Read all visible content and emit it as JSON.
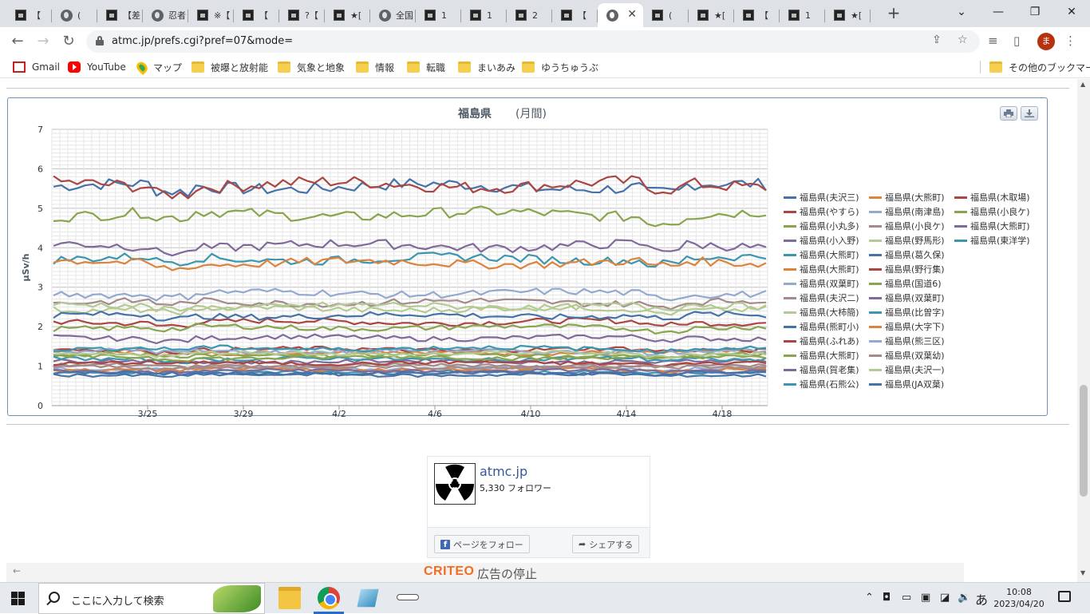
{
  "browser": {
    "tabs": [
      {
        "title": "【",
        "fav": "site"
      },
      {
        "title": "(",
        "fav": "globe"
      },
      {
        "title": "【差",
        "fav": "site"
      },
      {
        "title": "忍者",
        "fav": "globe"
      },
      {
        "title": "※【",
        "fav": "site"
      },
      {
        "title": "【",
        "fav": "site"
      },
      {
        "title": "?【",
        "fav": "site"
      },
      {
        "title": "★[",
        "fav": "site"
      },
      {
        "title": "全国",
        "fav": "globe"
      },
      {
        "title": "1",
        "fav": "site"
      },
      {
        "title": "1",
        "fav": "site"
      },
      {
        "title": "2",
        "fav": "site"
      },
      {
        "title": "【",
        "fav": "site"
      },
      {
        "title": "",
        "fav": "globe",
        "active": true
      },
      {
        "title": "(",
        "fav": "site"
      },
      {
        "title": "★[",
        "fav": "site"
      },
      {
        "title": "【",
        "fav": "site"
      },
      {
        "title": "1",
        "fav": "site"
      },
      {
        "title": "★[",
        "fav": "site"
      }
    ],
    "url": "atmc.jp/prefs.cgi?pref=07&mode=",
    "avatar_letter": "ま",
    "bookmarks": [
      {
        "label": "Gmail",
        "icon": "gmail-icon"
      },
      {
        "label": "YouTube",
        "icon": "youtube-icon"
      },
      {
        "label": "マップ",
        "icon": "maps-icon"
      },
      {
        "label": "被曝と放射能",
        "icon": "folder-icon"
      },
      {
        "label": "気象と地象",
        "icon": "folder-icon"
      },
      {
        "label": "情報",
        "icon": "folder-icon"
      },
      {
        "label": "転職",
        "icon": "folder-icon"
      },
      {
        "label": "まいあみ",
        "icon": "folder-icon"
      },
      {
        "label": "ゆうちゅうぶ",
        "icon": "folder-icon"
      }
    ],
    "other_bookmarks": "その他のブックマーク"
  },
  "chart_data": {
    "type": "line",
    "title": "福島県",
    "subtitle": "(月間)",
    "ylabel": "μSv/h",
    "xlabel": "",
    "ylim": [
      0,
      7
    ],
    "y_ticks": [
      0,
      1,
      2,
      3,
      4,
      5,
      6,
      7
    ],
    "x_ticks": [
      "3/25",
      "3/29",
      "4/2",
      "4/6",
      "4/10",
      "4/14",
      "4/18"
    ],
    "grid": true,
    "legend_position": "right",
    "series": [
      {
        "name": "福島県(夫沢三)",
        "color": "#4572a7",
        "level": 5.55
      },
      {
        "name": "福島県(大熊町)",
        "color": "#db843d",
        "level": 1.35
      },
      {
        "name": "福島県(木取場)",
        "color": "#aa4643",
        "level": 5.6
      },
      {
        "name": "福島県(やすら)",
        "color": "#aa4643",
        "level": 2.12
      },
      {
        "name": "福島県(南津島)",
        "color": "#93a9cf",
        "level": 0.95
      },
      {
        "name": "福島県(小良ケ)",
        "color": "#89a54e",
        "level": 4.85
      },
      {
        "name": "福島県(小丸多)",
        "color": "#89a54e",
        "level": 1.28
      },
      {
        "name": "福島県(小良ケ)",
        "color": "#a48a8a",
        "level": 1.02
      },
      {
        "name": "福島県(大熊町)",
        "color": "#80699b",
        "level": 4.05
      },
      {
        "name": "福島県(小入野)",
        "color": "#80699b",
        "level": 1.72
      },
      {
        "name": "福島県(野馬形)",
        "color": "#b5ca92",
        "level": 2.45
      },
      {
        "name": "福島県(東洋学)",
        "color": "#3d96ae",
        "level": 0.85
      },
      {
        "name": "福島県(大熊町)",
        "color": "#3d96ae",
        "level": 3.72
      },
      {
        "name": "福島県(葛久保)",
        "color": "#4572a7",
        "level": 2.28
      },
      {
        "name": "福島県(大熊町)",
        "color": "#db843d",
        "level": 3.62
      },
      {
        "name": "福島県(野行集)",
        "color": "#aa4643",
        "level": 1.42
      },
      {
        "name": "福島県(双葉町)",
        "color": "#93a9cf",
        "level": 2.85
      },
      {
        "name": "福島県(国道6)",
        "color": "#89a54e",
        "level": 1.98
      },
      {
        "name": "福島県(夫沢二)",
        "color": "#a48a8a",
        "level": 2.62
      },
      {
        "name": "福島県(双葉町)",
        "color": "#80699b",
        "level": 1.12
      },
      {
        "name": "福島県(大柿簡)",
        "color": "#b5ca92",
        "level": 2.52
      },
      {
        "name": "福島県(比曽字)",
        "color": "#3d96ae",
        "level": 1.18
      },
      {
        "name": "福島県(熊町小)",
        "color": "#4572a7",
        "level": 0.78
      },
      {
        "name": "福島県(大字下)",
        "color": "#db843d",
        "level": 0.92
      },
      {
        "name": "福島県(ふれあ)",
        "color": "#aa4643",
        "level": 1.08
      },
      {
        "name": "福島県(熊三区)",
        "color": "#93a9cf",
        "level": 1.38
      },
      {
        "name": "福島県(大熊町)",
        "color": "#89a54e",
        "level": 1.22
      },
      {
        "name": "福島県(双葉幼)",
        "color": "#a48a8a",
        "level": 0.98
      },
      {
        "name": "福島県(賀老集)",
        "color": "#80699b",
        "level": 0.88
      },
      {
        "name": "福島県(夫沢一)",
        "color": "#b5ca92",
        "level": 1.32
      },
      {
        "name": "福島県(石熊公)",
        "color": "#3d96ae",
        "level": 1.45
      },
      {
        "name": "福島県(JA双葉)",
        "color": "#4572a7",
        "level": 0.82
      }
    ]
  },
  "facebook": {
    "page_name": "atmc.jp",
    "followers": "5,330 フォロワー",
    "follow_label": "ページをフォロー",
    "share_label": "シェアする"
  },
  "ad": {
    "brand": "CRITEO",
    "stop_label": "広告の停止"
  },
  "taskbar": {
    "search_placeholder": "ここに入力して検索",
    "ime": "あ",
    "time": "10:08",
    "date": "2023/04/20"
  }
}
